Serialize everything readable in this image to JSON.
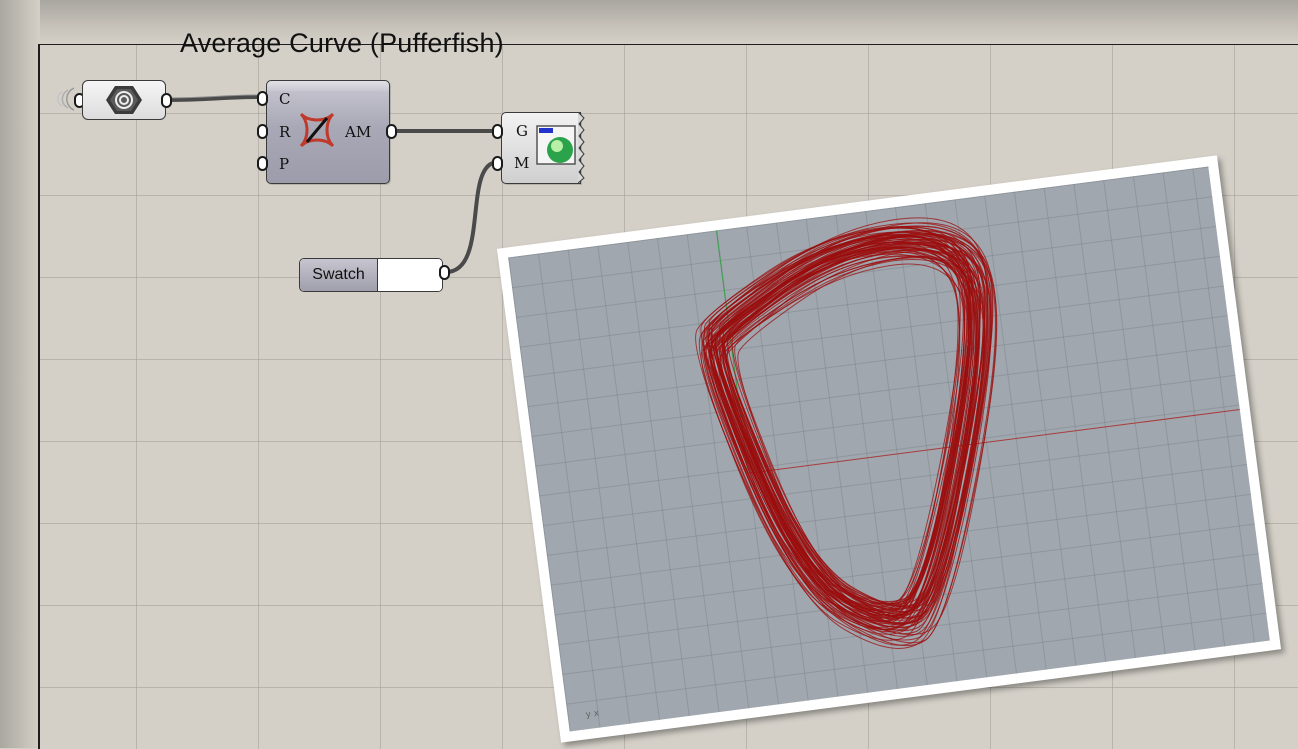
{
  "title": "Average Curve (Pufferfish)",
  "average_component": {
    "inputs": [
      "C",
      "R",
      "P"
    ],
    "output": "AM",
    "icon": "pufferfish-average-icon"
  },
  "param_node": {
    "icon": "curve-param-icon"
  },
  "preview_component": {
    "inputs": [
      "G",
      "M"
    ],
    "icon": "custom-preview-icon"
  },
  "swatch": {
    "label": "Swatch",
    "color": "#ffffff"
  },
  "viewport": {
    "curve_color": "#9b0e0e",
    "axis_x_color": "#a83c3c",
    "axis_y_color": "#3aa04a",
    "corner_axes": "y x"
  }
}
